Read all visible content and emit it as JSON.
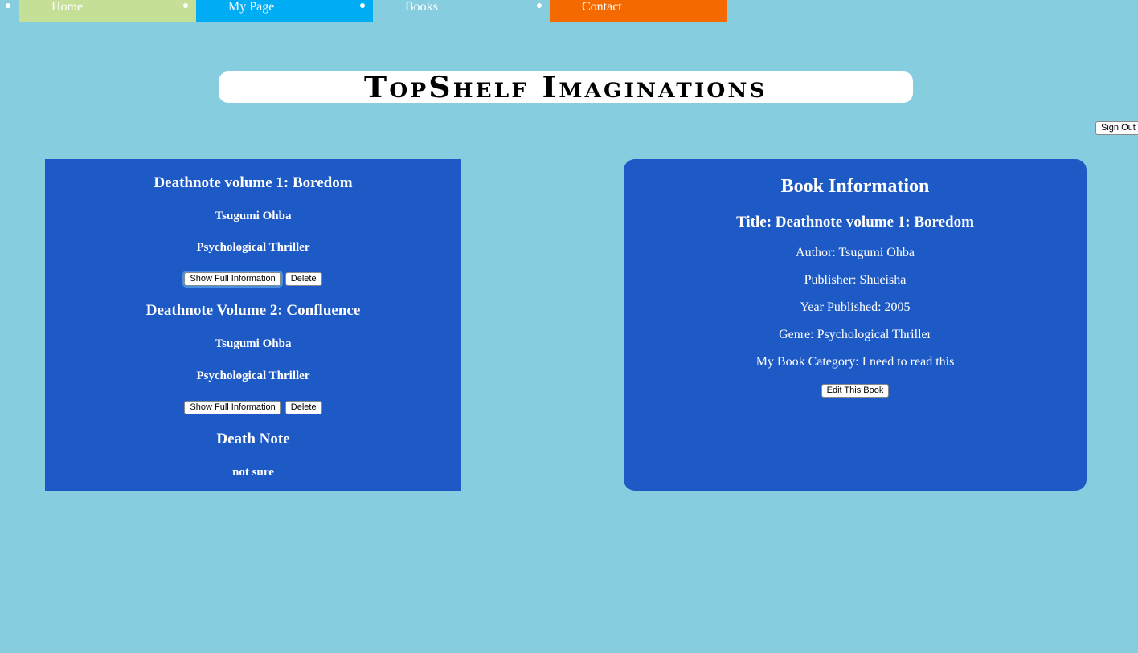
{
  "nav": {
    "items": [
      {
        "label": "Home",
        "color": "#c5df97"
      },
      {
        "label": "My Page",
        "color": "#00adf4"
      },
      {
        "label": "Books",
        "color": "#86cddf"
      },
      {
        "label": "Contact",
        "color": "#f46a00"
      }
    ]
  },
  "header": {
    "title": "TopShelf Imaginations"
  },
  "account": {
    "sign_out_label": "Sign Out"
  },
  "books": [
    {
      "title": "Deathnote volume 1: Boredom",
      "author": "Tsugumi Ohba",
      "genre": "Psychological Thriller",
      "show_label": "Show Full Information",
      "delete_label": "Delete"
    },
    {
      "title": "Deathnote Volume 2: Confluence",
      "author": "Tsugumi Ohba",
      "genre": "Psychological Thriller",
      "show_label": "Show Full Information",
      "delete_label": "Delete"
    },
    {
      "title": "Death Note",
      "author": "not sure"
    }
  ],
  "info": {
    "heading": "Book Information",
    "title": "Title: Deathnote volume 1: Boredom",
    "author": "Author: Tsugumi Ohba",
    "publisher": "Publisher: Shueisha",
    "year": "Year Published: 2005",
    "genre": "Genre: Psychological Thriller",
    "category": "My Book Category: I need to read this",
    "edit_label": "Edit This Book"
  },
  "colors": {
    "page_background": "#86cddf",
    "panel_background": "#1e5ac6"
  }
}
